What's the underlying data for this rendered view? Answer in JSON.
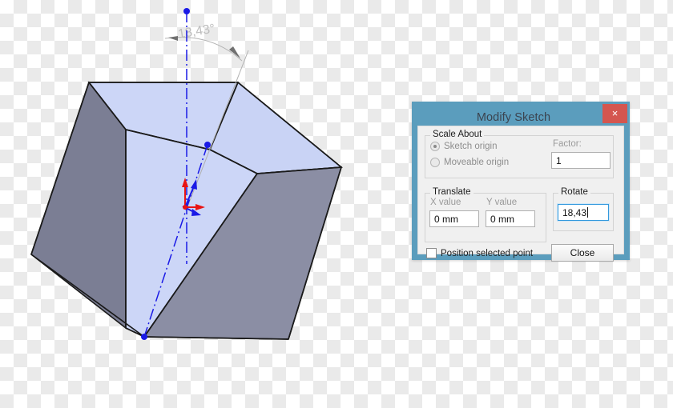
{
  "dialog": {
    "title": "Modify Sketch",
    "close_icon": "×",
    "scale_about": {
      "legend": "Scale About",
      "options": [
        {
          "label": "Sketch origin",
          "selected": true
        },
        {
          "label": "Moveable origin",
          "selected": false
        }
      ],
      "factor_label": "Factor:",
      "factor_value": "1"
    },
    "translate": {
      "legend": "Translate",
      "x_label": "X value",
      "y_label": "Y value",
      "x_value": "0 mm",
      "y_value": "0 mm"
    },
    "rotate": {
      "legend": "Rotate",
      "value": "18,43"
    },
    "position_selected_point": {
      "label": "Position selected point",
      "checked": false
    },
    "close_button_label": "Close"
  },
  "viewport": {
    "angle_dimension": "18,43°",
    "colors": {
      "face_light": "#ccd6f7",
      "face_light_2": "#c3cef2",
      "face_dark_left": "#7b7e94",
      "face_dark_right": "#8b8ea4",
      "face_dark_bottom_right": "#9093a8",
      "edge": "#1a1a1a",
      "sketch_blue": "#1a1ae6",
      "axis_red": "#e81414",
      "dimension_gray": "#a0a0a0",
      "dialog_frame": "#5b9dbd",
      "close_red": "#d4564f"
    }
  }
}
